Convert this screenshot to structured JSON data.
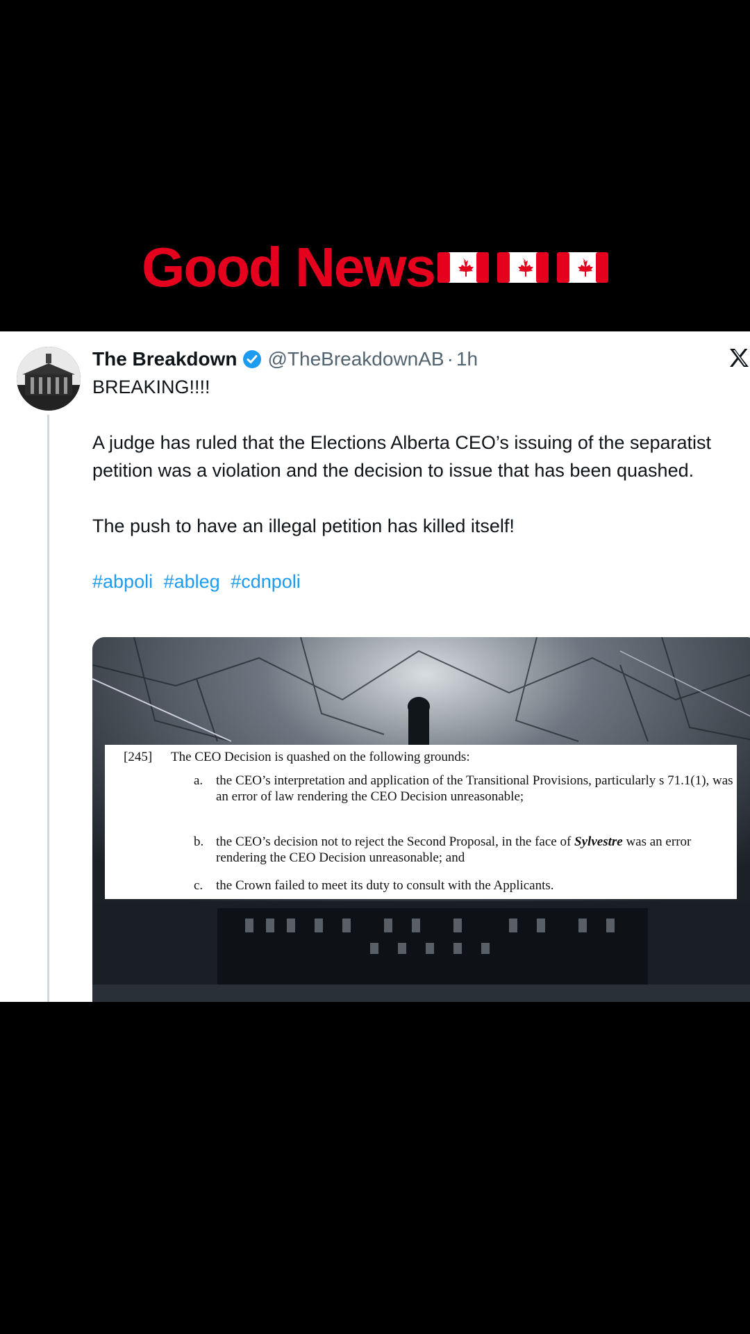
{
  "video_overlay": {
    "headline": "Good News",
    "flag_emoji_name": "canada-flag",
    "flag_count": 3,
    "headline_color": "#e5001d"
  },
  "tweet": {
    "display_name": "The Breakdown",
    "verified": true,
    "handle": "@TheBreakdownAB",
    "separator": "·",
    "time": "1h",
    "platform_icon": "x-logo-icon",
    "body": {
      "line1": "BREAKING!!!!",
      "para1": "A judge has ruled that the Elections Alberta CEO’s issuing of the separatist petition was a violation and the decision to issue that has been quashed.",
      "para2": "The push to have an illegal petition has killed itself!",
      "hashtags": [
        "#abpoli",
        "#ableg",
        "#cdnpoli"
      ]
    },
    "media": {
      "para_number": "[245]",
      "para_text": "The CEO Decision is quashed on the following grounds:",
      "items": [
        {
          "letter": "a.",
          "text": "the CEO’s interpretation and application of the Transitional Provisions, particularly s 71.1(1), was an error of law rendering the CEO Decision unreasonable;"
        },
        {
          "letter": "b.",
          "text_before": "the CEO’s decision not to reject the Second Proposal, in the face of ",
          "case_name": "Sylvestre",
          "text_after": " was an error rendering the CEO Decision unreasonable; and"
        },
        {
          "letter": "c.",
          "text": "the Crown failed to meet its duty to consult with the Applicants."
        }
      ]
    },
    "colors": {
      "hashtag": "#1d9bf0",
      "verified_badge": "#1d9bf0",
      "handle": "#536471",
      "text": "#0f1419"
    }
  }
}
